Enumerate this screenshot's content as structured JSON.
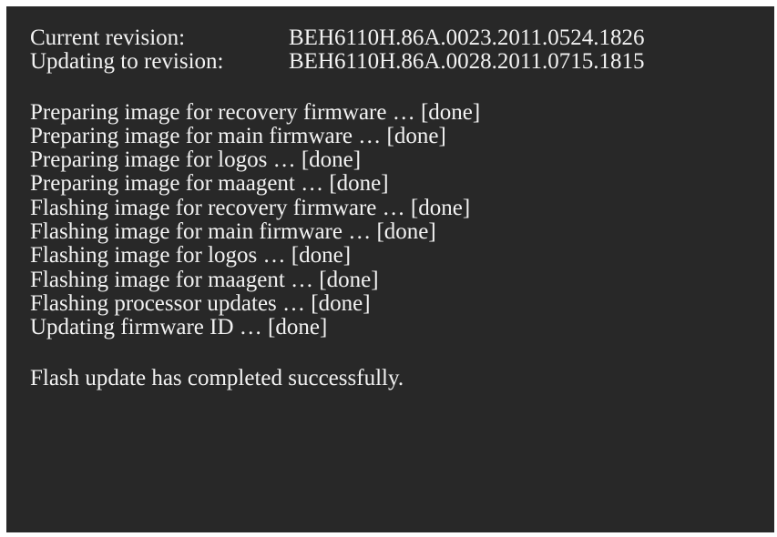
{
  "header": {
    "current": {
      "label": "Current revision:",
      "value": "BEH6110H.86A.0023.2011.0524.1826"
    },
    "updating": {
      "label": "Updating to revision:",
      "value": "BEH6110H.86A.0028.2011.0715.1815"
    }
  },
  "steps": [
    "Preparing image for recovery firmware … [done]",
    "Preparing image for main firmware … [done]",
    "Preparing image for logos … [done]",
    "Preparing image for maagent … [done]",
    "Flashing image for recovery firmware … [done]",
    "Flashing image for main firmware … [done]",
    "Flashing image for logos … [done]",
    "Flashing image for maagent … [done]",
    "Flashing processor updates … [done]",
    "Updating firmware ID … [done]"
  ],
  "footer": {
    "message": "Flash update has completed successfully."
  },
  "colors": {
    "background": "#282828",
    "text": "#f2f2f2",
    "page": "#ffffff"
  }
}
